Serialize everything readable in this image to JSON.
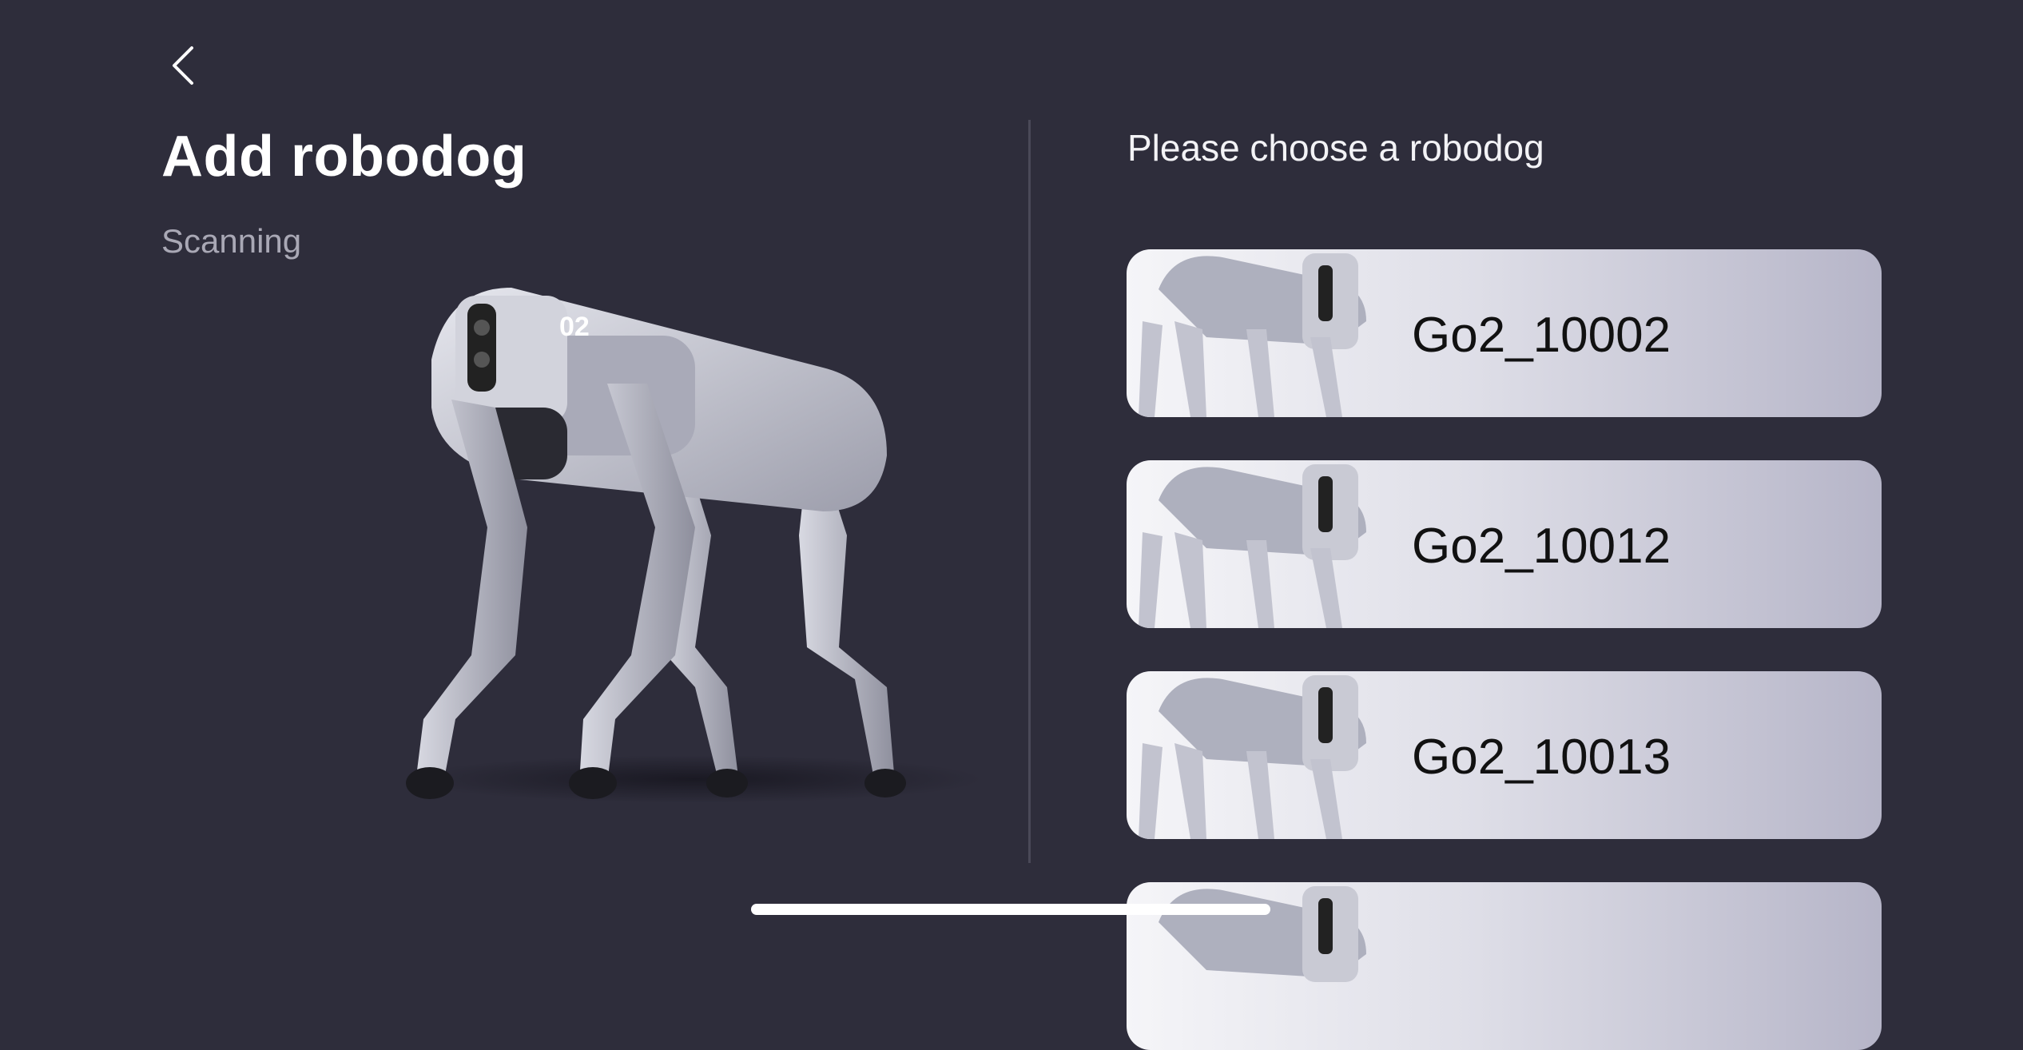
{
  "header": {
    "back_icon": "chevron-left-icon",
    "title": "Add robodog",
    "status": "Scanning"
  },
  "hero": {
    "badge": "02"
  },
  "list": {
    "title": "Please choose a robodog",
    "items": [
      {
        "name": "Go2_10002"
      },
      {
        "name": "Go2_10012"
      },
      {
        "name": "Go2_10013"
      },
      {
        "name": ""
      }
    ]
  },
  "colors": {
    "background": "#2e2d3b",
    "card_start": "#f5f5f8",
    "card_end": "#b6b5c8",
    "divider": "#4a4958"
  }
}
